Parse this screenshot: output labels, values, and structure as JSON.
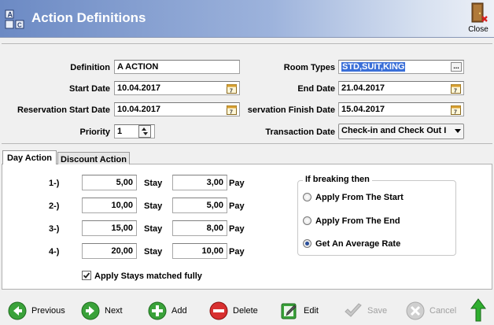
{
  "window": {
    "title": "Action Definitions",
    "close_label": "Close"
  },
  "form": {
    "definition_label": "Definition",
    "definition_value": "A ACTION",
    "start_date_label": "Start Date",
    "start_date_value": "10.04.2017",
    "res_start_date_label": "Reservation Start Date",
    "res_start_date_value": "10.04.2017",
    "priority_label": "Priority",
    "priority_value": "1",
    "room_types_label": "Room Types",
    "room_types_value": "STD,SUIT,KING",
    "room_types_btn": "...",
    "end_date_label": "End Date",
    "end_date_value": "21.04.2017",
    "res_finish_date_label": "servation Finish Date",
    "res_finish_date_value": "15.04.2017",
    "transaction_date_label": "Transaction Date",
    "transaction_date_value": "Check-in and Check Out I"
  },
  "tabs": [
    {
      "label": "Day Action",
      "active": true
    },
    {
      "label": "Discount Action",
      "active": false
    }
  ],
  "day_action": {
    "stay_label": "Stay",
    "pay_label": "Pay",
    "rows": [
      {
        "label": "1-)",
        "stay": "5,00",
        "pay": "3,00"
      },
      {
        "label": "2-)",
        "stay": "10,00",
        "pay": "5,00"
      },
      {
        "label": "3-)",
        "stay": "15,00",
        "pay": "8,00"
      },
      {
        "label": "4-)",
        "stay": "20,00",
        "pay": "10,00"
      }
    ],
    "apply_stays_label": "Apply Stays matched fully",
    "apply_stays_checked": true,
    "breaking_group": {
      "title": "If breaking then",
      "options": [
        {
          "label": "Apply From The Start",
          "selected": false
        },
        {
          "label": "Apply From The End",
          "selected": false
        },
        {
          "label": "Get An Average Rate",
          "selected": true
        }
      ]
    }
  },
  "toolbar": {
    "previous": "Previous",
    "next": "Next",
    "add": "Add",
    "delete": "Delete",
    "edit": "Edit",
    "save": "Save",
    "cancel": "Cancel"
  },
  "colors": {
    "header_start": "#6c8ac4",
    "selection": "#3a6fd8",
    "green_btn": "#3aa23a",
    "red_btn": "#d83030"
  }
}
